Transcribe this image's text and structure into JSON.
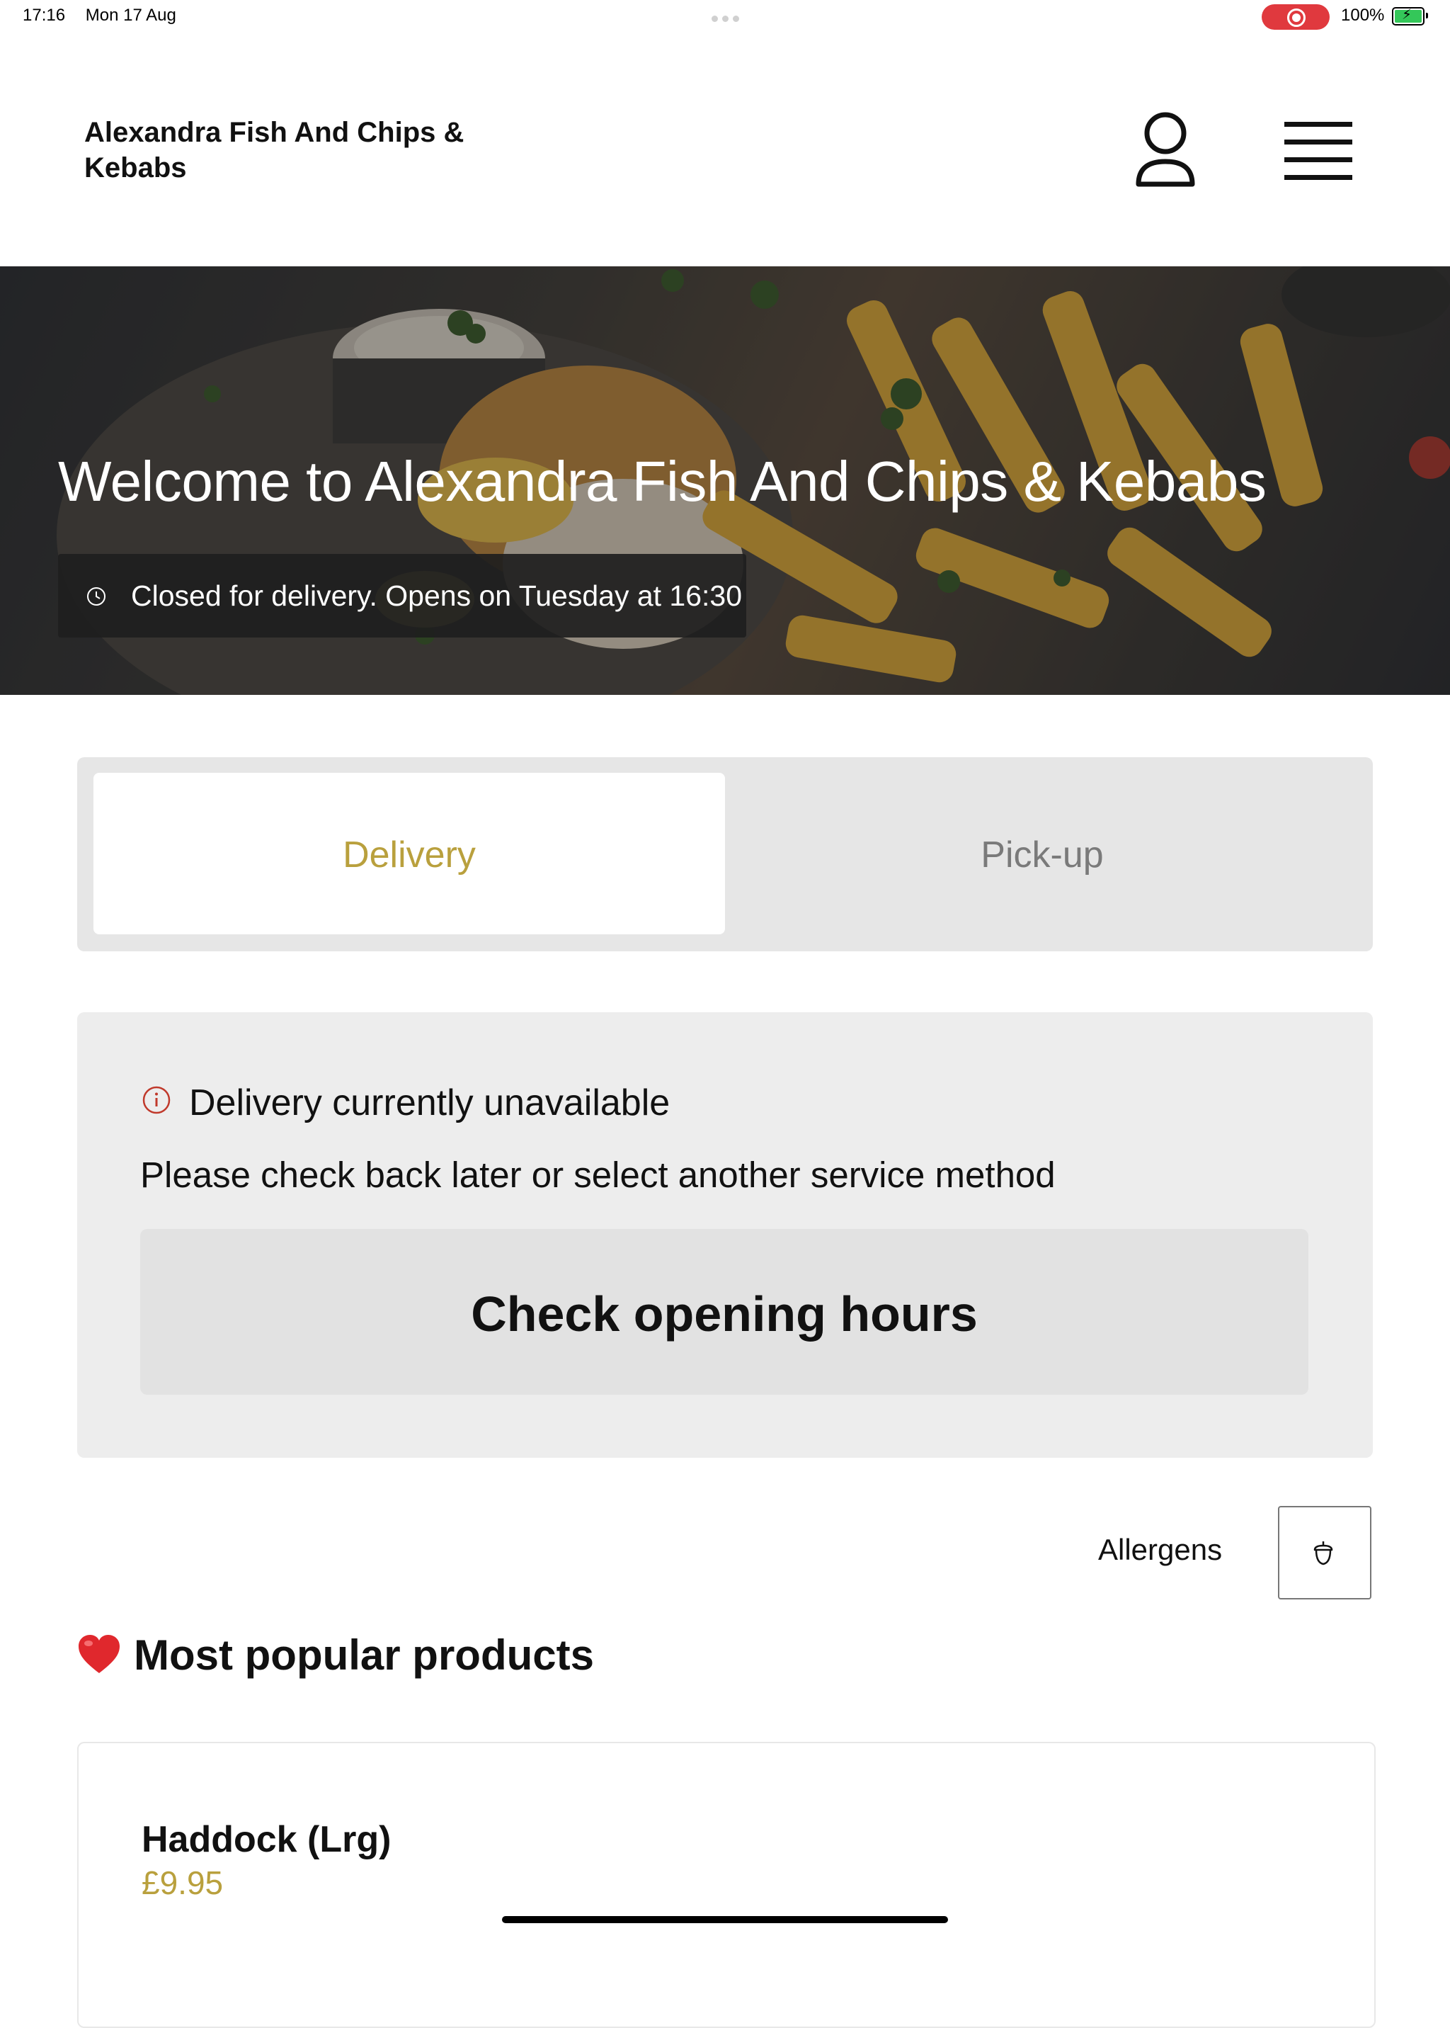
{
  "status_bar": {
    "time": "17:16",
    "date": "Mon 17 Aug",
    "battery": "100%"
  },
  "header": {
    "brand": "Alexandra Fish And Chips & Kebabs",
    "account_icon": "user-icon",
    "menu_icon": "hamburger-menu-icon"
  },
  "hero": {
    "title": "Welcome to Alexandra Fish And Chips & Kebabs",
    "status_text": "Closed for delivery. Opens on Tuesday at 16:30"
  },
  "service_toggle": {
    "options": [
      "Delivery",
      "Pick-up"
    ],
    "selected": "Delivery"
  },
  "notice": {
    "title": "Delivery currently unavailable",
    "subtitle": "Please check back later or select another service method",
    "button": "Check opening hours"
  },
  "allergens": {
    "label": "Allergens",
    "icon": "acorn-icon"
  },
  "popular": {
    "heading": "Most popular products",
    "products": [
      {
        "name": "Haddock (Lrg)",
        "price": "£9.95"
      }
    ]
  },
  "colors": {
    "accent": "#b9a03d",
    "record_pill": "#e0393e",
    "info_icon": "#c0392b"
  }
}
